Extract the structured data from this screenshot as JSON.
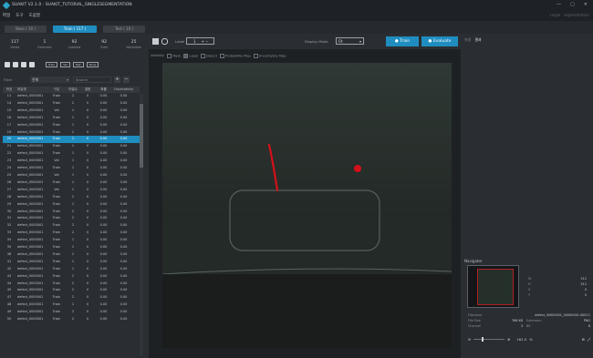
{
  "window": {
    "title": "SUAKIT V2.1.0 - SUAKIT_TUTORIAL_SINGLESEGMENTATION",
    "minimize": "—",
    "maximize": "▢",
    "close": "✕"
  },
  "menu": {
    "items": [
      "파일",
      "도구",
      "도움말"
    ],
    "right": [
      "single",
      "segmentation"
    ]
  },
  "tabs": [
    {
      "label": "Base ( 10 )"
    },
    {
      "label": "Train ( 117 )"
    },
    {
      "label": "Test ( 10 )"
    }
  ],
  "stats": [
    {
      "value": "117",
      "label": "Views"
    },
    {
      "value": "1",
      "label": "Selected"
    },
    {
      "value": "92",
      "label": "Labeled"
    },
    {
      "value": "92",
      "label": "Train"
    },
    {
      "value": "25",
      "label": "Validation"
    }
  ],
  "toolbar_buttons": [
    "Train",
    "Val",
    "Test",
    "None"
  ],
  "filter": {
    "label": "Filter",
    "value": "전체",
    "search_placeholder": "Search"
  },
  "grid": {
    "headers": [
      "번호",
      "파일명",
      "구분",
      "라벨수",
      "결함",
      "확률",
      "Uncertainty"
    ],
    "rows": [
      [
        "11",
        "defect_0000001",
        "Train",
        "2",
        "0",
        "0.00",
        "0.00"
      ],
      [
        "14",
        "defect_0000001",
        "Train",
        "2",
        "0",
        "0.00",
        "0.00"
      ],
      [
        "15",
        "defect_0000001",
        "Val",
        "1",
        "0",
        "0.00",
        "0.00"
      ],
      [
        "16",
        "defect_0000001",
        "Train",
        "1",
        "0",
        "0.00",
        "0.00"
      ],
      [
        "17",
        "defect_0000001",
        "Train",
        "1",
        "0",
        "0.00",
        "0.00"
      ],
      [
        "19",
        "defect_0000001",
        "Train",
        "2",
        "0",
        "0.00",
        "0.00"
      ],
      [
        "20",
        "defect_0000001",
        "Train",
        "1",
        "0",
        "0.00",
        "0.00"
      ],
      [
        "21",
        "defect_0000001",
        "Train",
        "1",
        "0",
        "0.00",
        "0.00"
      ],
      [
        "22",
        "defect_0000001",
        "Train",
        "1",
        "0",
        "0.00",
        "0.00"
      ],
      [
        "23",
        "defect_0000001",
        "Val",
        "1",
        "0",
        "0.00",
        "0.00"
      ],
      [
        "24",
        "defect_0000001",
        "Train",
        "1",
        "0",
        "0.00",
        "0.00"
      ],
      [
        "25",
        "defect_0000001",
        "Val",
        "1",
        "0",
        "0.00",
        "0.00"
      ],
      [
        "26",
        "defect_0000001",
        "Train",
        "1",
        "0",
        "0.00",
        "0.00"
      ],
      [
        "27",
        "defect_0000001",
        "Val",
        "1",
        "0",
        "0.00",
        "0.00"
      ],
      [
        "28",
        "defect_0000001",
        "Train",
        "2",
        "0",
        "0.00",
        "0.00"
      ],
      [
        "29",
        "defect_0000001",
        "Train",
        "1",
        "0",
        "0.00",
        "0.00"
      ],
      [
        "30",
        "defect_0000001",
        "Train",
        "2",
        "0",
        "0.00",
        "0.00"
      ],
      [
        "31",
        "defect_0000001",
        "Train",
        "2",
        "0",
        "0.00",
        "0.00"
      ],
      [
        "32",
        "defect_0000001",
        "Train",
        "2",
        "0",
        "0.00",
        "0.00"
      ],
      [
        "33",
        "defect_0000001",
        "Train",
        "2",
        "0",
        "0.00",
        "0.00"
      ],
      [
        "34",
        "defect_0000001",
        "Train",
        "1",
        "0",
        "0.00",
        "0.00"
      ],
      [
        "35",
        "defect_0000001",
        "Train",
        "1",
        "0",
        "0.00",
        "0.00"
      ],
      [
        "36",
        "defect_0000001",
        "Train",
        "2",
        "0",
        "0.00",
        "0.00"
      ],
      [
        "41",
        "defect_0000001",
        "Train",
        "1",
        "0",
        "0.00",
        "0.00"
      ],
      [
        "42",
        "defect_0000001",
        "Train",
        "1",
        "0",
        "0.00",
        "0.00"
      ],
      [
        "43",
        "defect_0000001",
        "Train",
        "2",
        "0",
        "0.00",
        "0.00"
      ],
      [
        "44",
        "defect_0000001",
        "Train",
        "2",
        "0",
        "0.00",
        "0.00"
      ],
      [
        "45",
        "defect_0000001",
        "Train",
        "2",
        "0",
        "0.00",
        "0.00"
      ],
      [
        "47",
        "defect_0000001",
        "Train",
        "2",
        "0",
        "0.00",
        "0.00"
      ],
      [
        "48",
        "defect_0000001",
        "Train",
        "1",
        "0",
        "0.00",
        "0.00"
      ],
      [
        "49",
        "defect_0000001",
        "Train",
        "2",
        "0",
        "0.00",
        "0.00"
      ],
      [
        "50",
        "defect_0000001",
        "Train",
        "2",
        "0",
        "0.00",
        "0.00"
      ]
    ],
    "selected_index": 6
  },
  "center": {
    "label_text": "Label",
    "label_value": "1",
    "display_mode_label": "Display Mode",
    "display_mode_value": "Fit",
    "train_label": "Train",
    "evaluate_label": "Evaluate",
    "visibility_label": "Visibility",
    "visibility_items": [
      "Mask",
      "Label",
      "Detect",
      "Probability Map",
      "Uncertainty Map"
    ]
  },
  "right": {
    "tabs": [
      "속성",
      "결과"
    ],
    "navigator_title": "Navigator",
    "nav_metrics": [
      {
        "k": "W",
        "v": "512"
      },
      {
        "k": "H",
        "v": "512"
      },
      {
        "k": "X",
        "v": "0"
      },
      {
        "k": "Y",
        "v": "0"
      }
    ],
    "file_info": [
      {
        "k": "Filename",
        "v": "defect_00000001_00000041.000C1"
      },
      {
        "k": "File Size",
        "v": "768 KB"
      },
      {
        "k": "Channel",
        "v": "3"
      }
    ],
    "file_info2": [
      {
        "k": "Extension",
        "v": "PNG"
      },
      {
        "k": "Bit",
        "v": "8"
      }
    ],
    "zoom": {
      "value": "161.5",
      "unit": "%"
    }
  },
  "colors": {
    "accent": "#1f8dc0",
    "defect": "#d4101a",
    "background": "#262a2e"
  }
}
